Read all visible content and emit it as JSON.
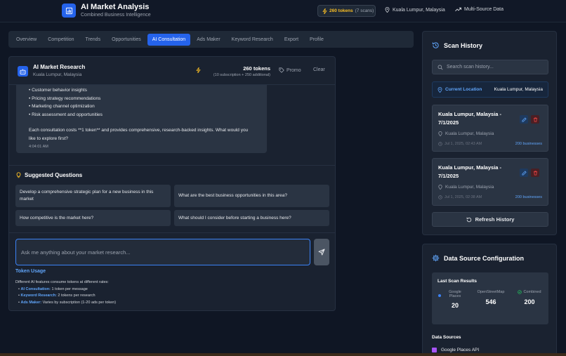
{
  "header": {
    "title": "AI Market Analysis",
    "subtitle": "Combined Business Intelligence",
    "tokens_count": "260 tokens",
    "tokens_scans": "(7 scans)",
    "location": "Kuala Lumpur, Malaysia",
    "source": "Multi-Source Data"
  },
  "tabs": [
    {
      "label": "Overview"
    },
    {
      "label": "Competition"
    },
    {
      "label": "Trends"
    },
    {
      "label": "Opportunities"
    },
    {
      "label": "AI Consultation"
    },
    {
      "label": "Ads Maker"
    },
    {
      "label": "Keyword Research"
    },
    {
      "label": "Export"
    },
    {
      "label": "Profile"
    }
  ],
  "chat": {
    "title": "AI Market Research",
    "location": "Kuala Lumpur, Malaysia",
    "tokens": "260 tokens",
    "tokens_detail": "(10 subscription + 250 additional)",
    "promo_label": "Promo",
    "clear_label": "Clear",
    "message_lines": [
      "• Customer behavior insights",
      "• Pricing strategy recommendations",
      "• Marketing channel optimization",
      "• Risk assessment and opportunities"
    ],
    "message_footer": "Each consultation costs **1 token** and provides comprehensive, research-backed insights. What would you like to explore first?",
    "message_time": "4:04:01 AM",
    "suggested_title": "Suggested Questions",
    "suggestions": [
      "Develop a comprehensive strategic plan for a new business in this market",
      "What are the best business opportunities in this area?",
      "How competitive is the market here?",
      "What should I consider before starting a business here?"
    ],
    "input_placeholder": "Ask me anything about your market research...",
    "token_usage_title": "Token Usage",
    "token_usage_intro": "Different AI features consume tokens at different rates:",
    "token_usage_items": [
      {
        "name": "AI Consultation:",
        "rate": "1 token per message"
      },
      {
        "name": "Keyword Research:",
        "rate": "2 tokens per research"
      },
      {
        "name": "Ads Maker:",
        "rate": "Varies by subscription (1-20 ads per token)"
      }
    ]
  },
  "scan_history": {
    "title": "Scan History",
    "search_placeholder": "Search scan history...",
    "current_location_label": "Current Location",
    "current_location_value": "Kuala Lumpur, Malaysia",
    "cards": [
      {
        "title": "Kuala Lumpur, Malaysia - 7/1/2025",
        "location": "Kuala Lumpur, Malaysia",
        "date": "Jul 1, 2025, 02:43 AM",
        "businesses": "200 businesses"
      },
      {
        "title": "Kuala Lumpur, Malaysia - 7/1/2025",
        "location": "Kuala Lumpur, Malaysia",
        "date": "Jul 1, 2025, 02:38 AM",
        "businesses": "200 businesses"
      }
    ],
    "refresh_label": "Refresh History"
  },
  "data_source": {
    "title": "Data Source Configuration",
    "last_scan_title": "Last Scan Results",
    "results": [
      {
        "label": "Google Places",
        "value": "20"
      },
      {
        "label": "OpenStreetMap",
        "value": "546"
      },
      {
        "label": "Combined",
        "value": "200"
      }
    ],
    "sources_title": "Data Sources",
    "sources": [
      {
        "label": "Google Places API",
        "checked": true
      }
    ]
  },
  "colors": {
    "accent": "#2563eb",
    "token_gold": "#fbbf24",
    "link_blue": "#60a5fa",
    "danger": "#ef4444",
    "success": "#22c55e"
  }
}
